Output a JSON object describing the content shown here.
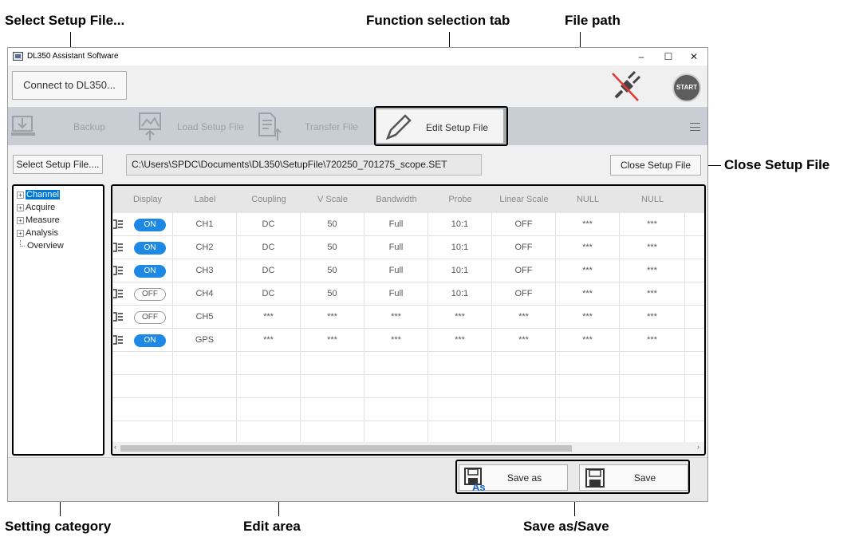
{
  "callouts": {
    "select_setup_file": "Select Setup File...",
    "function_selection_tab": "Function selection tab",
    "file_path": "File path",
    "close_setup_file": "Close Setup File",
    "setting_category": "Setting category",
    "edit_area": "Edit area",
    "save_as_save": "Save as/Save"
  },
  "window": {
    "title": "DL350 Assistant Software",
    "controls": {
      "minimize": "–",
      "maximize": "☐",
      "close": "✕"
    }
  },
  "topbar": {
    "connect_label": "Connect to DL350...",
    "start_label": "START"
  },
  "toolbar": {
    "backup": "Backup",
    "load_setup_file": "Load Setup File",
    "transfer_file": "Transfer File",
    "edit_setup_file": "Edit Setup File"
  },
  "file_row": {
    "select_setup_file": "Select Setup File....",
    "path": "C:\\Users\\SPDC\\Documents\\DL350\\SetupFile\\720250_701275_scope.SET",
    "close_setup_file": "Close Setup File"
  },
  "tree": {
    "items": [
      {
        "label": "Channel",
        "expandable": true,
        "selected": true
      },
      {
        "label": "Acquire",
        "expandable": true,
        "selected": false
      },
      {
        "label": "Measure",
        "expandable": true,
        "selected": false
      },
      {
        "label": "Analysis",
        "expandable": true,
        "selected": false
      },
      {
        "label": "Overview",
        "expandable": false,
        "selected": false
      }
    ]
  },
  "grid": {
    "columns": [
      "Display",
      "Label",
      "Coupling",
      "V Scale",
      "Bandwidth",
      "Probe",
      "Linear Scale",
      "NULL",
      "NULL"
    ],
    "rows": [
      {
        "display": "ON",
        "label": "CH1",
        "coupling": "DC",
        "vscale": "50",
        "bandwidth": "Full",
        "probe": "10:1",
        "linear": "OFF",
        "null1": "***",
        "null2": "***"
      },
      {
        "display": "ON",
        "label": "CH2",
        "coupling": "DC",
        "vscale": "50",
        "bandwidth": "Full",
        "probe": "10:1",
        "linear": "OFF",
        "null1": "***",
        "null2": "***"
      },
      {
        "display": "ON",
        "label": "CH3",
        "coupling": "DC",
        "vscale": "50",
        "bandwidth": "Full",
        "probe": "10:1",
        "linear": "OFF",
        "null1": "***",
        "null2": "***"
      },
      {
        "display": "OFF",
        "label": "CH4",
        "coupling": "DC",
        "vscale": "50",
        "bandwidth": "Full",
        "probe": "10:1",
        "linear": "OFF",
        "null1": "***",
        "null2": "***"
      },
      {
        "display": "OFF",
        "label": "CH5",
        "coupling": "***",
        "vscale": "***",
        "bandwidth": "***",
        "probe": "***",
        "linear": "***",
        "null1": "***",
        "null2": "***"
      },
      {
        "display": "ON",
        "label": "GPS",
        "coupling": "***",
        "vscale": "***",
        "bandwidth": "***",
        "probe": "***",
        "linear": "***",
        "null1": "***",
        "null2": "***"
      }
    ],
    "empty_rows": 4
  },
  "bottom": {
    "save_as": "Save as",
    "save": "Save",
    "as_badge": "As"
  },
  "colors": {
    "toggle_on": "#1e88e5",
    "selection": "#0078d7",
    "disconnect_slash": "#e53935",
    "toolbar_bg": "#c9ced4"
  },
  "icons": [
    "app-icon",
    "plug-disconnected-icon",
    "backup-icon",
    "load-setup-file-icon",
    "transfer-file-icon",
    "pencil-icon",
    "hamburger-menu-icon",
    "floppy-save-as-icon",
    "floppy-save-icon"
  ]
}
